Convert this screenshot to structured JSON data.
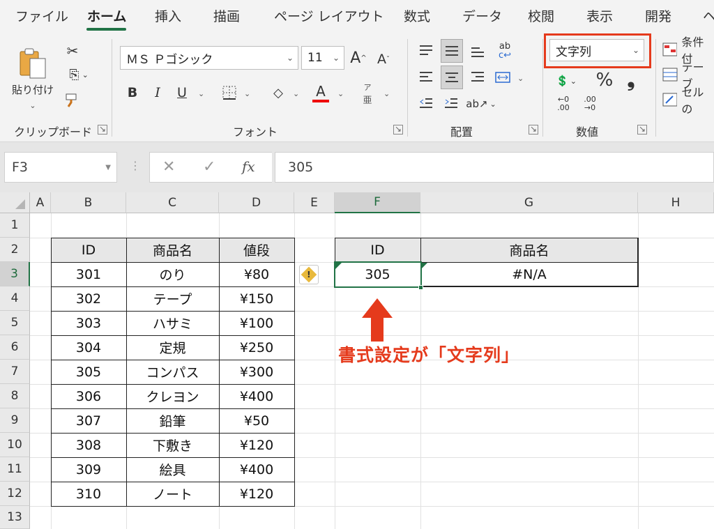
{
  "tabs": [
    "ファイル",
    "ホーム",
    "挿入",
    "描画",
    "ページ レイアウト",
    "数式",
    "データ",
    "校閲",
    "表示",
    "開発",
    "ヘ"
  ],
  "clipboard": {
    "paste_label": "貼り付け",
    "group_label": "クリップボード"
  },
  "font": {
    "name": "ＭＳ Ｐゴシック",
    "size": "11",
    "group_label": "フォント",
    "bold": "B",
    "italic": "I",
    "underline": "U",
    "font_color_glyph": "A",
    "grow": "A",
    "shrink": "A",
    "phonetic_top": "ア",
    "phonetic_bottom": "亜"
  },
  "alignment": {
    "group_label": "配置",
    "wrap": "ab"
  },
  "number": {
    "format": "文字列",
    "group_label": "数値",
    "percent": "%",
    "comma": "❟",
    "inc_decimal_top": "←0",
    "inc_decimal_bottom": ".00",
    "dec_decimal_top": ".00",
    "dec_decimal_bottom": "→0"
  },
  "styles": {
    "conditional": "条件付",
    "table": "テーブ",
    "cell": "セルの"
  },
  "formula_bar": {
    "name_box": "F3",
    "fx": "fx",
    "value": "305"
  },
  "columns": [
    "A",
    "B",
    "C",
    "D",
    "E",
    "F",
    "G",
    "H"
  ],
  "rows": [
    "1",
    "2",
    "3",
    "4",
    "5",
    "6",
    "7",
    "8",
    "9",
    "10",
    "11",
    "12",
    "13"
  ],
  "product_table": {
    "headers": [
      "ID",
      "商品名",
      "値段"
    ],
    "rows": [
      [
        "301",
        "のり",
        "¥80"
      ],
      [
        "302",
        "テープ",
        "¥150"
      ],
      [
        "303",
        "ハサミ",
        "¥100"
      ],
      [
        "304",
        "定規",
        "¥250"
      ],
      [
        "305",
        "コンパス",
        "¥300"
      ],
      [
        "306",
        "クレヨン",
        "¥400"
      ],
      [
        "307",
        "鉛筆",
        "¥50"
      ],
      [
        "308",
        "下敷き",
        "¥120"
      ],
      [
        "309",
        "絵具",
        "¥400"
      ],
      [
        "310",
        "ノート",
        "¥120"
      ]
    ]
  },
  "lookup_table": {
    "headers": [
      "ID",
      "商品名"
    ],
    "row": [
      "305",
      "#N/A"
    ]
  },
  "error_icon": "!",
  "annotation": "書式設定が「文字列」",
  "colors": {
    "accent": "#217346",
    "highlight": "#e53a1c",
    "error_icon": "#e8b93c"
  }
}
